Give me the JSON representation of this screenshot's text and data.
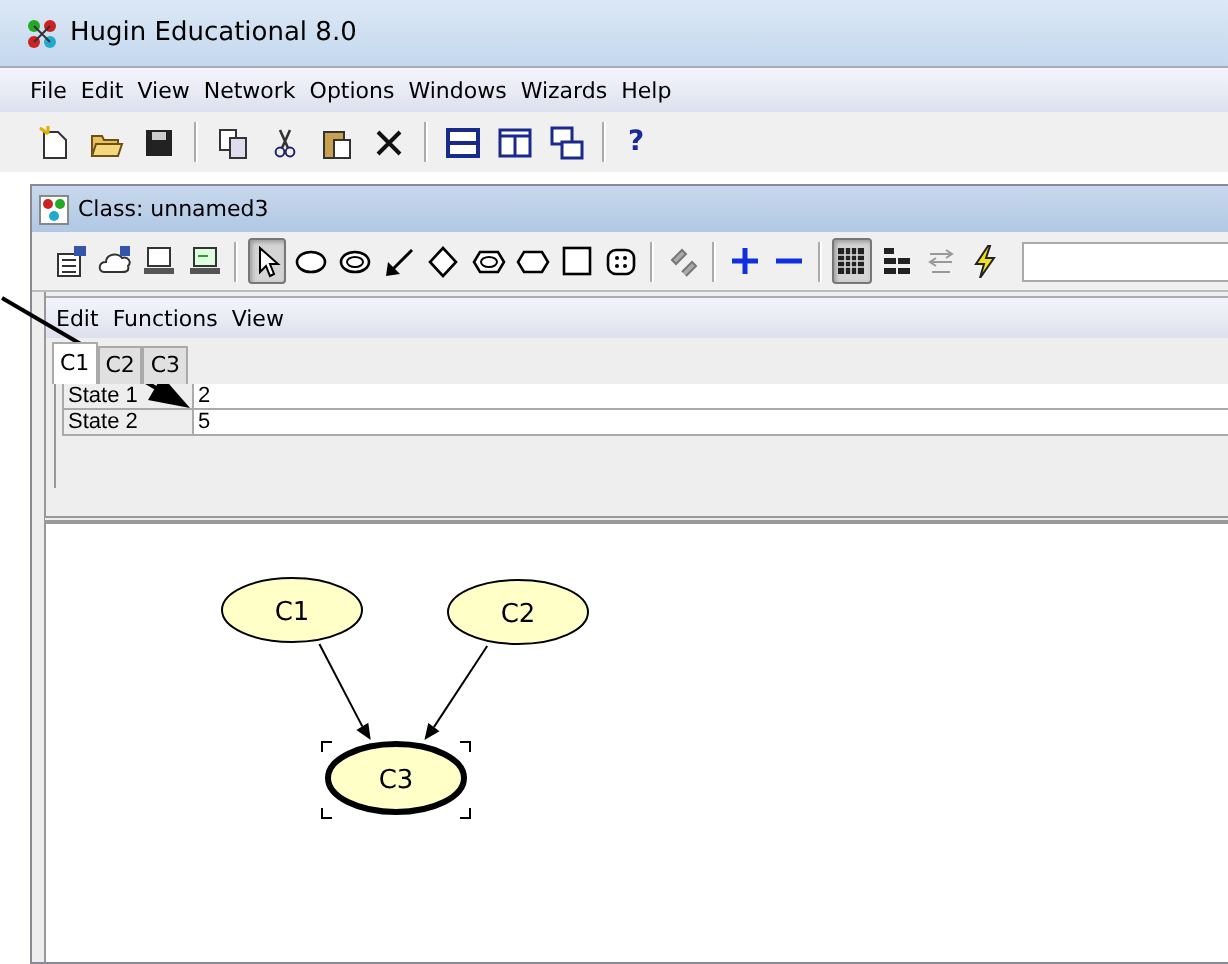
{
  "window": {
    "title": "Hugin Educational 8.0"
  },
  "menu": [
    "File",
    "Edit",
    "View",
    "Network",
    "Options",
    "Windows",
    "Wizards",
    "Help"
  ],
  "main_toolbar": [
    {
      "kind": "new"
    },
    {
      "kind": "open"
    },
    {
      "kind": "save"
    },
    {
      "kind": "sep"
    },
    {
      "kind": "copy"
    },
    {
      "kind": "cut"
    },
    {
      "kind": "paste"
    },
    {
      "kind": "delete"
    },
    {
      "kind": "sep"
    },
    {
      "kind": "tile-h"
    },
    {
      "kind": "tile-v"
    },
    {
      "kind": "cascade"
    },
    {
      "kind": "sep"
    },
    {
      "kind": "help",
      "label": "?"
    }
  ],
  "class_window": {
    "title": "Class: unnamed3",
    "tools": [
      {
        "kind": "props",
        "selected": false
      },
      {
        "kind": "cloud",
        "selected": false
      },
      {
        "kind": "monitor",
        "selected": false
      },
      {
        "kind": "monitor2",
        "selected": false
      },
      {
        "kind": "sep"
      },
      {
        "kind": "pointer",
        "selected": true
      },
      {
        "kind": "ellipse",
        "selected": false
      },
      {
        "kind": "ring",
        "selected": false
      },
      {
        "kind": "link",
        "selected": false
      },
      {
        "kind": "diamond",
        "selected": false
      },
      {
        "kind": "hexring",
        "selected": false
      },
      {
        "kind": "hexagon",
        "selected": false
      },
      {
        "kind": "square",
        "selected": false
      },
      {
        "kind": "dots",
        "selected": false
      },
      {
        "kind": "sep"
      },
      {
        "kind": "zigzag",
        "selected": false
      },
      {
        "kind": "sep"
      },
      {
        "kind": "plus",
        "selected": false
      },
      {
        "kind": "minus",
        "selected": false
      },
      {
        "kind": "sep"
      },
      {
        "kind": "table",
        "selected": true
      },
      {
        "kind": "bricks",
        "selected": false
      },
      {
        "kind": "em",
        "selected": false
      },
      {
        "kind": "bolt",
        "selected": false
      }
    ],
    "menu": [
      "Edit",
      "Functions",
      "View"
    ],
    "tabs": [
      {
        "label": "C1",
        "selected": true
      },
      {
        "label": "C2",
        "selected": false
      },
      {
        "label": "C3",
        "selected": false
      }
    ],
    "table": [
      {
        "state": "State 1",
        "value": "2"
      },
      {
        "state": "State 2",
        "value": "5"
      }
    ],
    "nodes": [
      {
        "label": "C1",
        "selected": false
      },
      {
        "label": "C2",
        "selected": false
      },
      {
        "label": "C3",
        "selected": true
      }
    ]
  }
}
